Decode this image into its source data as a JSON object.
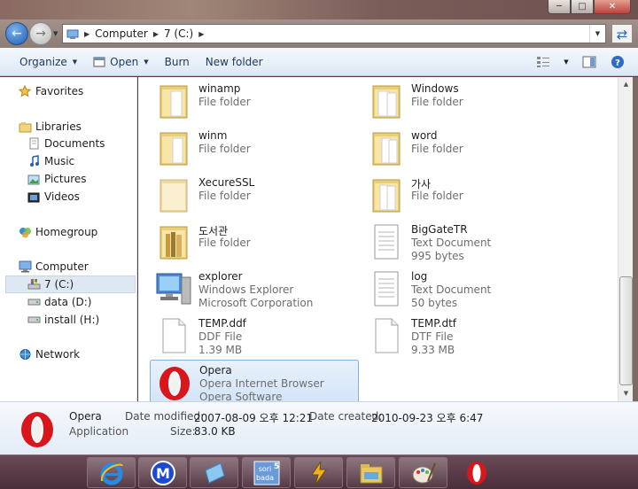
{
  "window": {
    "caption": {
      "minimize": "─",
      "maximize": "□",
      "close": "✕"
    }
  },
  "address_bar": {
    "crumbs": [
      "Computer",
      "7 (C:)"
    ],
    "refresh_icon": "refresh-icon"
  },
  "toolbar": {
    "organize": "Organize",
    "open": "Open",
    "burn": "Burn",
    "new_folder": "New folder"
  },
  "nav": {
    "favorites": "Favorites",
    "libraries": "Libraries",
    "documents": "Documents",
    "music": "Music",
    "pictures": "Pictures",
    "videos": "Videos",
    "homegroup": "Homegroup",
    "computer": "Computer",
    "drive_c": "7 (C:)",
    "drive_d": "data (D:)",
    "drive_h": "install (H:)",
    "network": "Network"
  },
  "files": [
    {
      "name": "winamp",
      "line2": "File folder",
      "line3": "",
      "icon": "folder-icon"
    },
    {
      "name": "Windows",
      "line2": "File folder",
      "line3": "",
      "icon": "folder-icon"
    },
    {
      "name": "winm",
      "line2": "File folder",
      "line3": "",
      "icon": "folder-icon"
    },
    {
      "name": "word",
      "line2": "File folder",
      "line3": "",
      "icon": "folder-icon"
    },
    {
      "name": "XecureSSL",
      "line2": "File folder",
      "line3": "",
      "icon": "folder-icon"
    },
    {
      "name": "가사",
      "line2": "File folder",
      "line3": "",
      "icon": "folder-icon"
    },
    {
      "name": "도서관",
      "line2": "File folder",
      "line3": "",
      "icon": "folder-icon"
    },
    {
      "name": "BigGateTR",
      "line2": "Text Document",
      "line3": "995 bytes",
      "icon": "text-document-icon"
    },
    {
      "name": "explorer",
      "line2": "Windows Explorer",
      "line3": "Microsoft Corporation",
      "icon": "explorer-icon"
    },
    {
      "name": "log",
      "line2": "Text Document",
      "line3": "50 bytes",
      "icon": "text-document-icon"
    },
    {
      "name": "TEMP.ddf",
      "line2": "DDF File",
      "line3": "1.39 MB",
      "icon": "blank-file-icon"
    },
    {
      "name": "TEMP.dtf",
      "line2": "DTF File",
      "line3": "9.33 MB",
      "icon": "blank-file-icon"
    },
    {
      "name": "Opera",
      "line2": "Opera Internet Browser",
      "line3": "Opera Software",
      "icon": "opera-icon"
    }
  ],
  "details": {
    "name": "Opera",
    "type": "Application",
    "modified_label": "Date modified:",
    "modified_value": "2007-08-09 오후 12:21",
    "created_label": "Date created:",
    "created_value": "2010-09-23 오후 6:47",
    "size_label": "Size:",
    "size_value": "83.0 KB"
  },
  "taskbar": {
    "buttons": [
      "internet-explorer-icon",
      "m-app-icon",
      "folder-shortcut-icon",
      "sorisbada-icon",
      "winamp-icon",
      "windows-explorer-icon",
      "paint-icon",
      "opera-icon"
    ],
    "sorisbada_text": "sori bada",
    "sorisbada_num": "5"
  }
}
